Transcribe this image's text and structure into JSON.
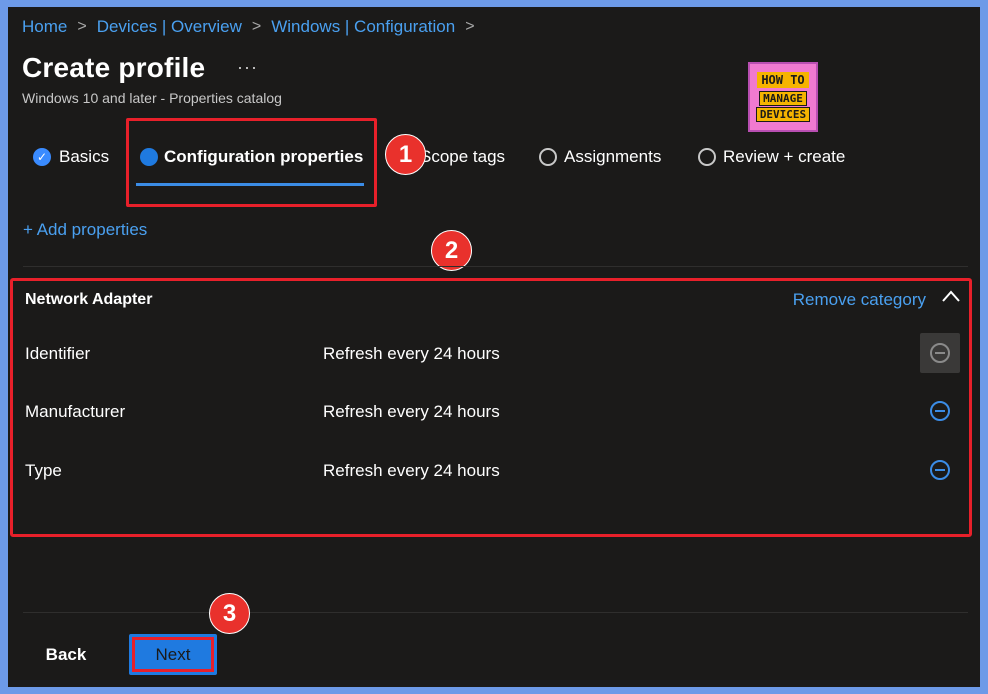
{
  "breadcrumb": {
    "items": [
      "Home",
      "Devices | Overview",
      "Windows | Configuration"
    ],
    "separator": ">"
  },
  "header": {
    "title": "Create profile",
    "more": "···",
    "subtitle": "Windows 10 and later - Properties catalog"
  },
  "logo": {
    "line1": "HOW TO",
    "line2": "MANAGE",
    "line3": "DEVICES",
    "colors": {
      "background": "#f07ad0",
      "accent": "#f6b400"
    }
  },
  "tabs": [
    {
      "label": "Basics",
      "state": "completed"
    },
    {
      "label": "Configuration properties",
      "state": "current"
    },
    {
      "label": "Scope tags",
      "state": "pending"
    },
    {
      "label": "Assignments",
      "state": "pending"
    },
    {
      "label": "Review + create",
      "state": "pending"
    }
  ],
  "annotations": {
    "badge1": "1",
    "badge2": "2",
    "badge3": "3",
    "color": "#e9312c"
  },
  "add_properties": "+ Add properties",
  "section": {
    "title": "Network Adapter",
    "remove_category": "Remove category",
    "rows": [
      {
        "property": "Identifier",
        "value": "Refresh every 24 hours"
      },
      {
        "property": "Manufacturer",
        "value": "Refresh every 24 hours"
      },
      {
        "property": "Type",
        "value": "Refresh every 24 hours"
      }
    ]
  },
  "footer": {
    "back_label": "Back",
    "next_label": "Next"
  },
  "colors": {
    "accent": "#1f7ae0",
    "link": "#4aa0f0",
    "background": "#1b1a19",
    "highlight": "#e8202a"
  }
}
